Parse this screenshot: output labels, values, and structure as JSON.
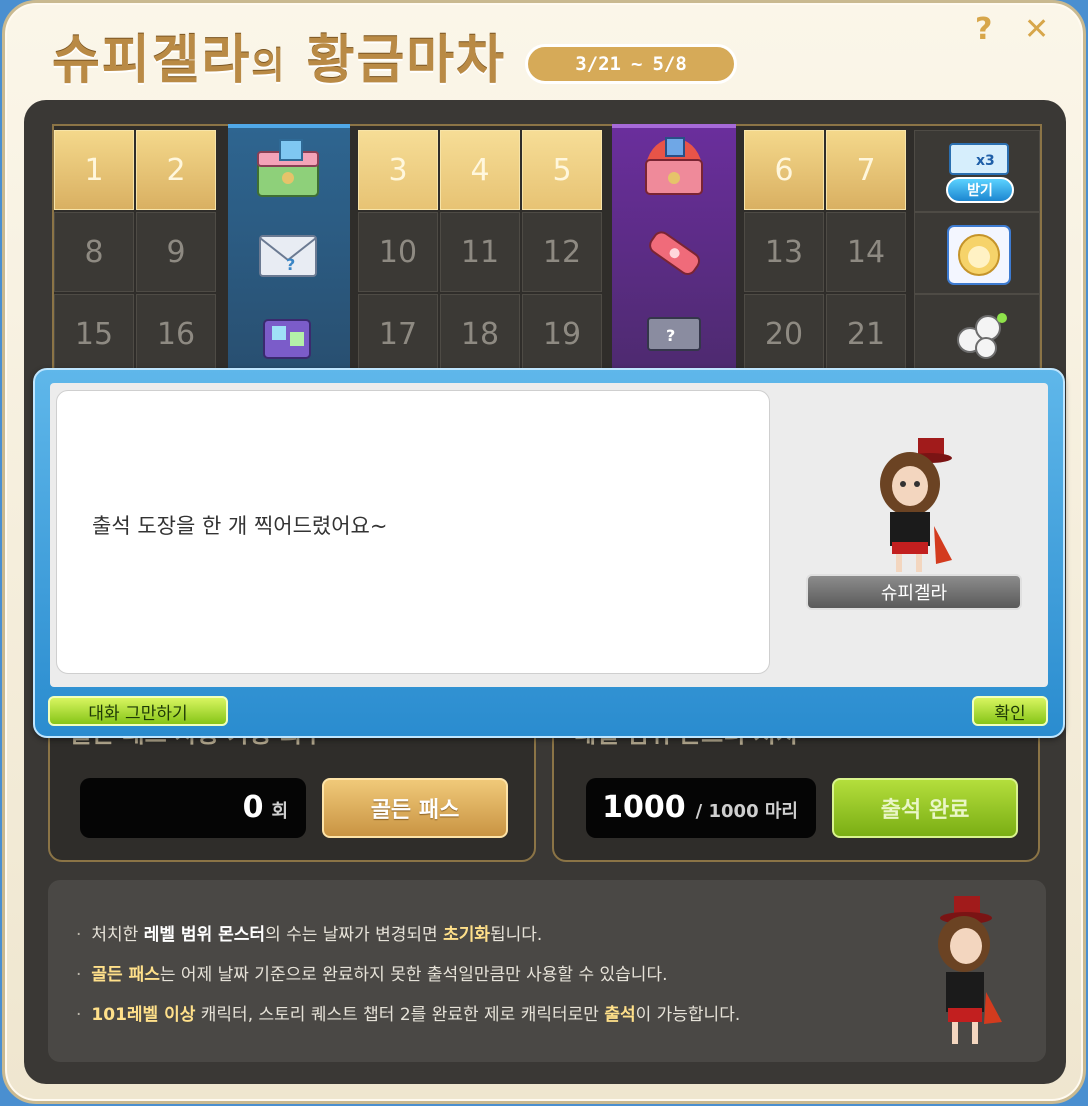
{
  "header": {
    "title_main": "슈피겔라",
    "title_particle": "의",
    "title_rest": "황금마차",
    "date_start": "3/21",
    "date_sep": "~",
    "date_end": "5/8",
    "help_glyph": "?",
    "close_glyph": "✕"
  },
  "calendar": {
    "days_row1": [
      "1",
      "2",
      "3",
      "4",
      "5",
      "6",
      "7"
    ],
    "days_row2": [
      "8",
      "9",
      "10",
      "11",
      "12",
      "13",
      "14"
    ],
    "days_row3": [
      "15",
      "16",
      "17",
      "18",
      "19",
      "20",
      "21"
    ],
    "reward_badge_label": "받기",
    "icons": [
      "gift-box-icon",
      "lot-envelope-icon",
      "cube-bundle-icon",
      "fire-box-icon",
      "coupon-icon",
      "ticket-icon",
      "exp-ticket-icon",
      "lion-icon",
      "white-orb-icon"
    ]
  },
  "golden_pass": {
    "header": "골든 패스 사용 가능 회수",
    "count": "0",
    "unit": "회",
    "button_label": "골든 패스"
  },
  "monster": {
    "header": "레벨 범위 몬스터 처치",
    "count": "1000",
    "of": "/ 1000 마리",
    "button_label": "출석 완료"
  },
  "notes": {
    "bullet": "·",
    "n1_a": "처치한 ",
    "n1_b": "레벨 범위 몬스터",
    "n1_c": "의 수는 날짜가 변경되면 ",
    "n1_d": "초기화",
    "n1_e": "됩니다.",
    "n2_a": "골든 패스",
    "n2_b": "는 어제 날짜 기준으로 완료하지 못한 출석일만큼만 사용할 수 있습니다.",
    "n3_a": "101레벨 이상",
    "n3_b": " 캐릭터, 스토리 퀘스트 챕터 2를 완료한 제로 캐릭터로만 ",
    "n3_c": "출석",
    "n3_d": "이 가능합니다."
  },
  "dialog": {
    "text": "출석 도장을 한 개 찍어드렸어요~",
    "npc_name": "슈피겔라",
    "stop_label": "대화 그만하기",
    "ok_label": "확인"
  },
  "colors": {
    "gold": "#d9b062",
    "blue_column": "#2e6590",
    "purple_column": "#6a2e9c",
    "dialog_blue": "#2a8ccf",
    "lime": "#86c518"
  }
}
